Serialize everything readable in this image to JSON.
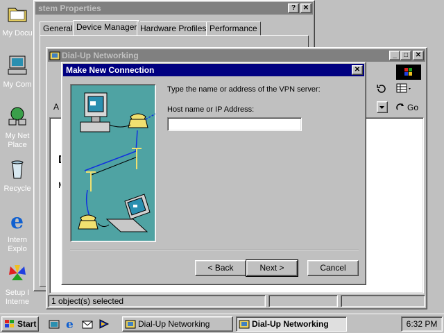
{
  "desktop": {
    "icons": [
      {
        "label": "My Docu",
        "icon": "folder-icon"
      },
      {
        "label": "My Com",
        "icon": "computer-icon"
      },
      {
        "label": "My Net",
        "label2": "Place",
        "icon": "network-icon"
      },
      {
        "label": "Recycle",
        "icon": "recycle-bin-icon"
      },
      {
        "label": "Intern",
        "label2": "Explo",
        "icon": "ie-icon"
      },
      {
        "label": "Setup I",
        "label2": "Interne",
        "icon": "msn-icon"
      }
    ]
  },
  "system_properties": {
    "title": "stem Properties",
    "help_btn": "?",
    "close_btn": "✕",
    "tabs": [
      "General",
      "Device Manager",
      "Hardware Profiles",
      "Performance"
    ]
  },
  "dialup_window": {
    "title": "Dial-Up Networking",
    "min_btn": "_",
    "max_btn": "□",
    "close_btn": "✕",
    "address_fragment": "A",
    "go_label": "Go",
    "body_letters": [
      "D",
      "M"
    ],
    "status_text": "1 object(s) selected"
  },
  "wizard": {
    "title": "Make New Connection",
    "close_btn": "✕",
    "prompt": "Type the name or address of the VPN server:",
    "host_label": "Host name or IP Address:",
    "host_value": "",
    "back_btn": "< Back",
    "next_btn": "Next >",
    "cancel_btn": "Cancel"
  },
  "taskbar": {
    "start_label": "Start",
    "tasks": [
      {
        "label": "Dial-Up Networking",
        "active": false
      },
      {
        "label": "Dial-Up Networking",
        "active": true
      }
    ],
    "clock": "6:32 PM"
  },
  "colors": {
    "desktop": "#c0c0c0",
    "active_title": "#000080",
    "inactive_title": "#808080",
    "illustration_bg": "#4fa3a3"
  }
}
